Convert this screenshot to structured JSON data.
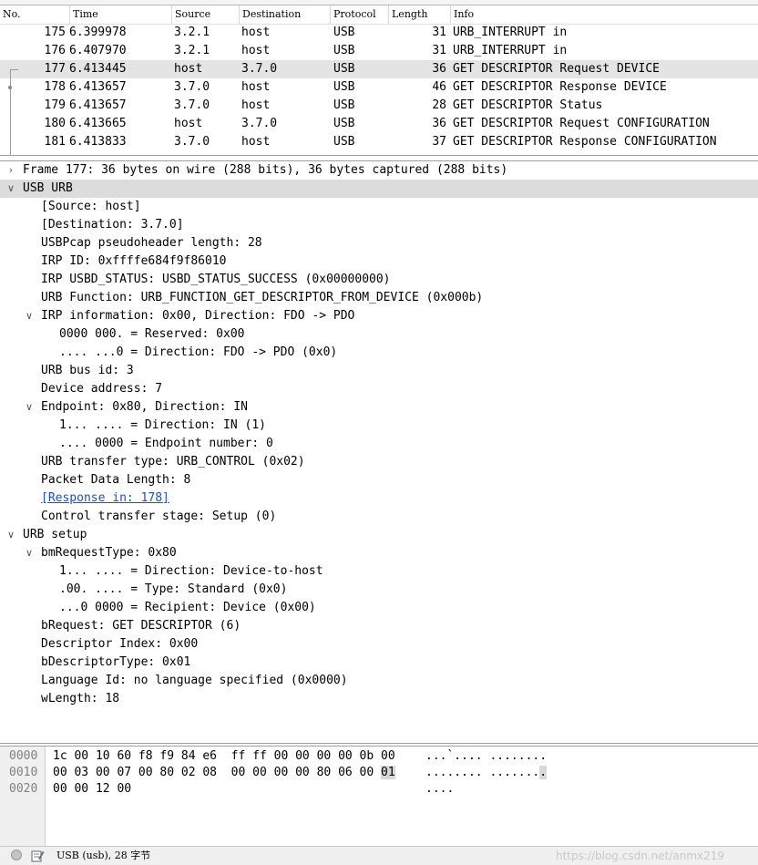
{
  "packet_list": {
    "columns": [
      "No.",
      "Time",
      "Source",
      "Destination",
      "Protocol",
      "Length",
      "Info"
    ],
    "rows": [
      {
        "no": "175",
        "time": "6.399978",
        "src": "3.2.1",
        "dst": "host",
        "proto": "USB",
        "len": "31",
        "info": "URB_INTERRUPT in"
      },
      {
        "no": "176",
        "time": "6.407970",
        "src": "3.2.1",
        "dst": "host",
        "proto": "USB",
        "len": "31",
        "info": "URB_INTERRUPT in"
      },
      {
        "no": "177",
        "time": "6.413445",
        "src": "host",
        "dst": "3.7.0",
        "proto": "USB",
        "len": "36",
        "info": "GET DESCRIPTOR Request DEVICE"
      },
      {
        "no": "178",
        "time": "6.413657",
        "src": "3.7.0",
        "dst": "host",
        "proto": "USB",
        "len": "46",
        "info": "GET DESCRIPTOR Response DEVICE"
      },
      {
        "no": "179",
        "time": "6.413657",
        "src": "3.7.0",
        "dst": "host",
        "proto": "USB",
        "len": "28",
        "info": "GET DESCRIPTOR Status"
      },
      {
        "no": "180",
        "time": "6.413665",
        "src": "host",
        "dst": "3.7.0",
        "proto": "USB",
        "len": "36",
        "info": "GET DESCRIPTOR Request CONFIGURATION"
      },
      {
        "no": "181",
        "time": "6.413833",
        "src": "3.7.0",
        "dst": "host",
        "proto": "USB",
        "len": "37",
        "info": "GET DESCRIPTOR Response CONFIGURATION"
      }
    ]
  },
  "details": {
    "lines": [
      "Frame 177: 36 bytes on wire (288 bits), 36 bytes captured (288 bits)",
      "USB URB",
      "[Source: host]",
      "[Destination: 3.7.0]",
      "USBPcap pseudoheader length: 28",
      "IRP ID: 0xffffe684f9f86010",
      "IRP USBD_STATUS: USBD_STATUS_SUCCESS (0x00000000)",
      "URB Function: URB_FUNCTION_GET_DESCRIPTOR_FROM_DEVICE (0x000b)",
      "IRP information: 0x00, Direction: FDO -> PDO",
      "0000 000. = Reserved: 0x00",
      ".... ...0 = Direction: FDO -> PDO (0x0)",
      "URB bus id: 3",
      "Device address: 7",
      "Endpoint: 0x80, Direction: IN",
      "1... .... = Direction: IN (1)",
      ".... 0000 = Endpoint number: 0",
      "URB transfer type: URB_CONTROL (0x02)",
      "Packet Data Length: 8",
      "[Response in: 178]",
      "Control transfer stage: Setup (0)",
      "URB setup",
      "bmRequestType: 0x80",
      "1... .... = Direction: Device-to-host",
      ".00. .... = Type: Standard (0x0)",
      "...0 0000 = Recipient: Device (0x00)",
      "bRequest: GET DESCRIPTOR (6)",
      "Descriptor Index: 0x00",
      "bDescriptorType: 0x01",
      "Language Id: no language specified (0x0000)",
      "wLength: 18"
    ]
  },
  "bytes": {
    "rows": [
      {
        "offset": "0000",
        "hex_a": "1c 00 10 60 f8 f9 84 e6  ff ff 00 00 00 00 0b 00",
        "hex_b": "",
        "ascii_a": "...`.... ........",
        "ascii_b": ""
      },
      {
        "offset": "0010",
        "hex_a": "00 03 00 07 00 80 02 08  00 00 00 00 80 06 00 ",
        "hex_b": "01",
        "ascii_a": "........ .......",
        "ascii_b": "."
      },
      {
        "offset": "0020",
        "hex_a": "00 00 12 00",
        "hex_b": "",
        "ascii_a": "....",
        "ascii_b": ""
      }
    ]
  },
  "statusbar": {
    "text": "USB (usb), 28 字节",
    "watermark": "https://blog.csdn.net/anmx219"
  },
  "icons": {
    "expanded": "chevron-down",
    "collapsed": "chevron-right",
    "status": "ready-dot",
    "edit": "edit-note"
  }
}
